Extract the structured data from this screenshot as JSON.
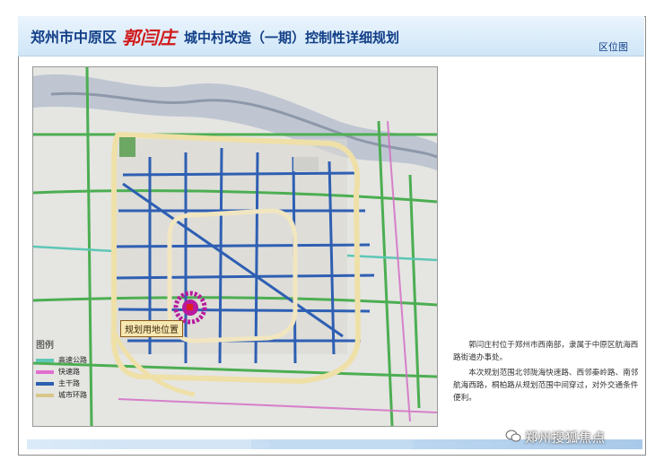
{
  "header": {
    "title_prefix": "郑州市中原区",
    "title_name": "郭闫庄",
    "title_suffix": "城中村改造（一期）控制性详细规划",
    "subtitle": "区位图"
  },
  "map": {
    "callout_label": "规划用地位置",
    "legend": {
      "title": "图例",
      "items": [
        {
          "label": "高速公路",
          "color": "#5dc7b5"
        },
        {
          "label": "快速路",
          "color": "#e06fd0"
        },
        {
          "label": "主干路",
          "color": "#2d5fb0"
        },
        {
          "label": "城市环路",
          "color": "#d9c78a"
        }
      ]
    },
    "colors": {
      "ring_road": "#efe0a8",
      "arterial": "#2e5fb3",
      "expressway": "#4cae52",
      "inner_ring": "#f2e6c0",
      "river": "#aeb8c9",
      "site_marker": "#b8199e"
    }
  },
  "description": {
    "paragraph1": "郭闫庄村位于郑州市西南部，隶属于中原区航海西路街道办事处。",
    "paragraph2": "本次规划范围北邻陇海快速路、西邻秦岭路、南邻航海西路，桐柏路从规划范围中间穿过，对外交通条件便利。"
  },
  "watermark": {
    "text": "郑州搜狐焦点",
    "icon": "wechat-icon"
  }
}
